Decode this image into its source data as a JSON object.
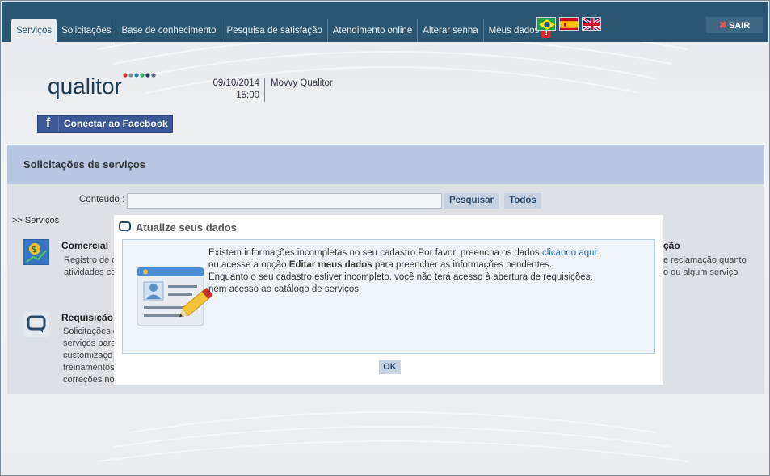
{
  "nav": {
    "items": [
      {
        "label": "Serviços",
        "active": true
      },
      {
        "label": "Solicitações"
      },
      {
        "label": "Base de conhecimento"
      },
      {
        "label": "Pesquisa de satisfação"
      },
      {
        "label": "Atendimento online"
      },
      {
        "label": "Alterar senha"
      },
      {
        "label": "Meus dados",
        "badge": "!"
      }
    ],
    "flags": [
      "brazil-flag-icon",
      "spain-flag-icon",
      "uk-flag-icon"
    ],
    "logout_label": "SAIR"
  },
  "header": {
    "logo_text": "qualitor",
    "date": "09/10/2014",
    "time": "15:00",
    "company": "Movvy Qualitor",
    "facebook_label": "Conectar ao Facebook"
  },
  "page": {
    "title": "Solicitações de serviços",
    "search_label": "Conteúdo :",
    "search_value": "",
    "search_button": "Pesquisar",
    "all_button": "Todos",
    "breadcrumb": ">> Serviços"
  },
  "services": [
    {
      "title": "Comercial",
      "desc_lines": [
        "Registro de d",
        "atividades co"
      ],
      "icon": "money-growth-icon"
    },
    {
      "title": "Requisição d",
      "desc_lines": [
        "Solicitações d",
        "serviços para",
        "customizaçõ",
        "treinamentos",
        "correções no"
      ],
      "icon": "chat-bubble-icon"
    },
    {
      "title": "ção",
      "desc_lines": [
        "e reclamação quanto",
        "o ou algum serviço"
      ],
      "icon": ""
    }
  ],
  "modal": {
    "title": "Atualize seus dados",
    "msg_part1": "Existem informações incompletas no seu cadastro.Por favor, preencha os dados ",
    "link": "clicando aqui",
    "msg_part2": " ,",
    "msg_part3": "ou acesse a opção ",
    "bold": "Editar meus dados",
    "msg_part4": " para preencher as informações pendentes.",
    "msg_line3": "Enquanto o seu cadastro estiver incompleto, você não terá acesso à abertura de requisições,",
    "msg_line4": "nem acesso ao catálogo de serviços.",
    "ok_label": "OK"
  },
  "colors": {
    "topbar": "#2b5671",
    "section_header": "#b9c7e3",
    "link": "#2a6fb5"
  }
}
